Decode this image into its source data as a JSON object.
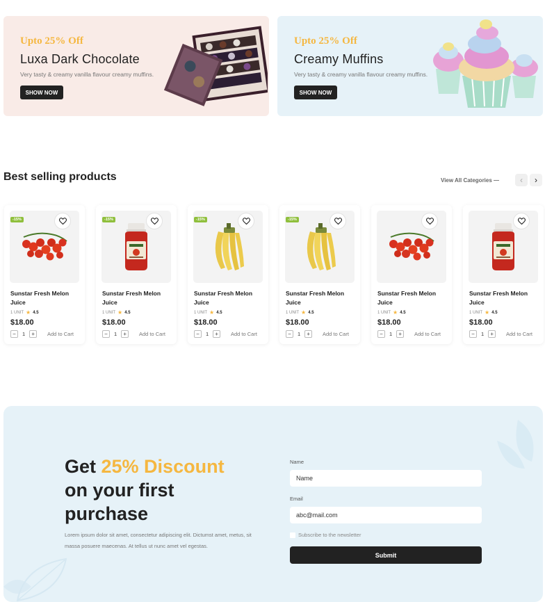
{
  "banners": [
    {
      "promo": "Upto 25% Off",
      "title": "Luxa Dark Chocolate",
      "description": "Very tasty & creamy vanilla flavour creamy muffins.",
      "button": "SHOW NOW",
      "image_icon": "chocolate-box-image"
    },
    {
      "promo": "Upto 25% Off",
      "title": "Creamy Muffins",
      "description": "Very tasty & creamy vanilla flavour creamy muffins.",
      "button": "SHOW NOW",
      "image_icon": "cupcakes-image"
    }
  ],
  "best_selling": {
    "title": "Best selling products",
    "view_all": "View All Categories —",
    "prev_icon": "‹",
    "next_icon": "›",
    "products": [
      {
        "badge": "-15%",
        "image": "tomatoes",
        "name": "Sunstar Fresh Melon Juice",
        "unit": "1 UNIT",
        "rating": "4.5",
        "price": "$18.00",
        "qty": "1",
        "add": "Add to Cart"
      },
      {
        "badge": "-15%",
        "image": "ketchup",
        "name": "Sunstar Fresh Melon Juice",
        "unit": "1 UNIT",
        "rating": "4.5",
        "price": "$18.00",
        "qty": "1",
        "add": "Add to Cart"
      },
      {
        "badge": "-15%",
        "image": "bananas",
        "name": "Sunstar Fresh Melon Juice",
        "unit": "1 UNIT",
        "rating": "4.5",
        "price": "$18.00",
        "qty": "1",
        "add": "Add to Cart"
      },
      {
        "badge": "-15%",
        "image": "bananas",
        "name": "Sunstar Fresh Melon Juice",
        "unit": "1 UNIT",
        "rating": "4.5",
        "price": "$18.00",
        "qty": "1",
        "add": "Add to Cart"
      },
      {
        "badge": "",
        "image": "tomatoes",
        "name": "Sunstar Fresh Melon Juice",
        "unit": "1 UNIT",
        "rating": "4.5",
        "price": "$18.00",
        "qty": "1",
        "add": "Add to Cart"
      },
      {
        "badge": "",
        "image": "ketchup",
        "name": "Sunstar Fresh Melon Juice",
        "unit": "1 UNIT",
        "rating": "4.5",
        "price": "$18.00",
        "qty": "1",
        "add": "Add to Cart"
      }
    ]
  },
  "newsletter": {
    "heading_pre": "Get ",
    "heading_accent": "25% Discount",
    "heading_post": "on your first purchase",
    "body": "Lorem ipsum dolor sit amet, consectetur adipiscing elit. Dictumst amet, metus, sit massa posuere maecenas. At tellus ut nunc amet vel egestas.",
    "name_label": "Name",
    "name_value": "Name",
    "email_label": "Email",
    "email_value": "abc@mail.com",
    "subscribe": "Subscribe to the newsletter",
    "submit": "Submit"
  },
  "colors": {
    "accent": "#f5b740",
    "dark": "#222222",
    "badge": "#8fbf3c",
    "banner_pink": "#f9ebe7",
    "banner_blue": "#e6f2f8"
  }
}
